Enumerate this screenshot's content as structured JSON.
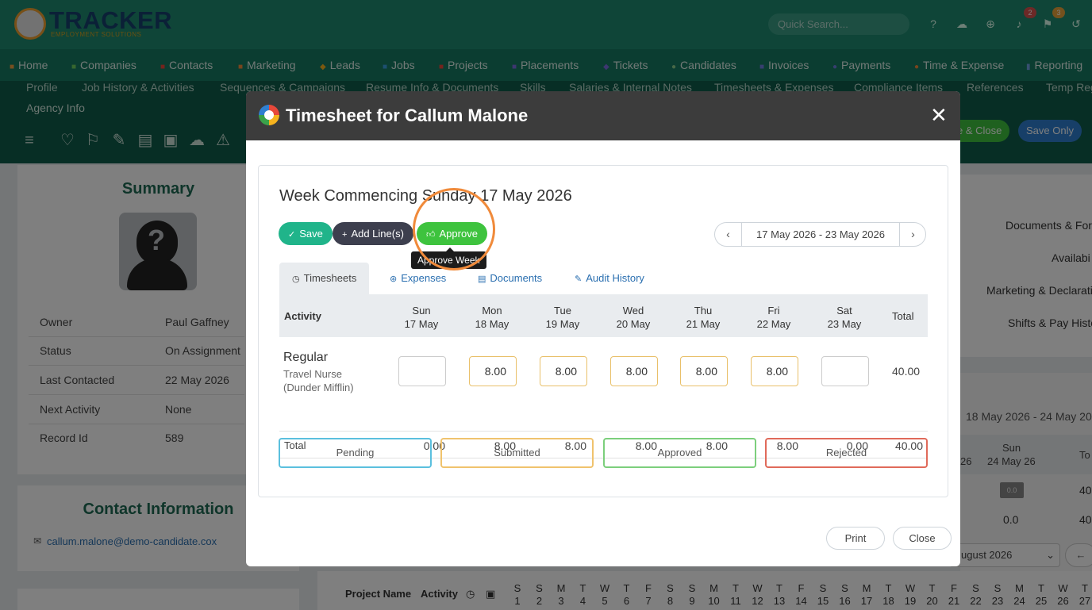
{
  "app": {
    "logo_text": "TRACKER",
    "logo_sub": "EMPLOYMENT SOLUTIONS",
    "quick_search_placeholder": "Quick Search...",
    "badges": {
      "notifications": "2",
      "flags": "3"
    }
  },
  "nav": [
    "Home",
    "Companies",
    "Contacts",
    "Marketing",
    "Leads",
    "Jobs",
    "Projects",
    "Placements",
    "Tickets",
    "Candidates",
    "Invoices",
    "Payments",
    "Time & Expense",
    "Reporting"
  ],
  "subnav": [
    "Profile",
    "Job History & Activities",
    "Sequences & Campaigns",
    "Resume Info & Documents",
    "Skills",
    "Salaries & Internal Notes",
    "Timesheets & Expenses",
    "Compliance Items",
    "References",
    "Temp Reg"
  ],
  "agency_info": "Agency Info",
  "bg_buttons": {
    "save_close": "e & Close",
    "save_only": "Save Only"
  },
  "summary": {
    "title": "Summary",
    "rows": [
      {
        "label": "Owner",
        "value": "Paul Gaffney"
      },
      {
        "label": "Status",
        "value": "On Assignment"
      },
      {
        "label": "Last Contacted",
        "value": "22 May 2026"
      },
      {
        "label": "Next Activity",
        "value": "None"
      },
      {
        "label": "Record Id",
        "value": "589"
      }
    ]
  },
  "contact": {
    "title": "Contact Information",
    "email": "callum.malone@demo-candidate.cox"
  },
  "right_panel": {
    "labels": [
      "Documents & For",
      "Availabi",
      "Marketing & Declarati",
      "Shifts & Pay Histo"
    ],
    "date_range": "18 May 2026 - 24 May 20",
    "sun_header": "Sun",
    "sun_date": "24 May 26",
    "col_26": "26",
    "to_col": "To",
    "val_00": "0.0",
    "val_40": "40",
    "month_select": "ugust 2026"
  },
  "bottom_grid": {
    "project_name": "Project Name",
    "activity": "Activity",
    "days": [
      "S",
      "S",
      "M",
      "T",
      "W",
      "T",
      "F",
      "S",
      "S",
      "M",
      "T",
      "W",
      "T",
      "F",
      "S",
      "S",
      "M",
      "T",
      "W",
      "T",
      "F",
      "S",
      "S",
      "M",
      "T",
      "W",
      "T"
    ],
    "nums": [
      "1",
      "2",
      "3",
      "4",
      "5",
      "6",
      "7",
      "8",
      "9",
      "10",
      "11",
      "12",
      "13",
      "14",
      "15",
      "16",
      "17",
      "18",
      "19",
      "20",
      "21",
      "22",
      "23",
      "24",
      "25",
      "26",
      "27"
    ]
  },
  "modal": {
    "title": "Timesheet for Callum Malone",
    "week_title": "Week Commencing Sunday 17 May 2026",
    "buttons": {
      "save": "Save",
      "add_lines": "Add Line(s)",
      "approve": "Approve"
    },
    "tooltip": "Approve Week",
    "date_range": "17 May 2026 - 23 May 2026",
    "tabs": [
      "Timesheets",
      "Expenses",
      "Documents",
      "Audit History"
    ],
    "table": {
      "activity_header": "Activity",
      "total_header": "Total",
      "days": [
        {
          "day": "Sun",
          "date": "17 May"
        },
        {
          "day": "Mon",
          "date": "18 May"
        },
        {
          "day": "Tue",
          "date": "19 May"
        },
        {
          "day": "Wed",
          "date": "20 May"
        },
        {
          "day": "Thu",
          "date": "21 May"
        },
        {
          "day": "Fri",
          "date": "22 May"
        },
        {
          "day": "Sat",
          "date": "23 May"
        }
      ],
      "row": {
        "name": "Regular",
        "description": "Travel Nurse (Dunder Mifflin)",
        "hours": [
          "",
          "8.00",
          "8.00",
          "8.00",
          "8.00",
          "8.00",
          ""
        ],
        "total": "40.00"
      },
      "totals_label": "Total",
      "totals": [
        "0.00",
        "8.00",
        "8.00",
        "8.00",
        "8.00",
        "8.00",
        "0.00"
      ],
      "grand_total": "40.00"
    },
    "statuses": [
      {
        "label": "Pending",
        "color": "#5bc0de"
      },
      {
        "label": "Submitted",
        "color": "#f0c36d"
      },
      {
        "label": "Approved",
        "color": "#7ccf7c"
      },
      {
        "label": "Rejected",
        "color": "#e06a5a"
      }
    ],
    "footer": {
      "print": "Print",
      "close": "Close"
    },
    "colors": {
      "save": "#20b48a",
      "add_lines": "#3d3f4e",
      "approve": "#3ec33e",
      "highlight": "#f08a3a"
    }
  }
}
